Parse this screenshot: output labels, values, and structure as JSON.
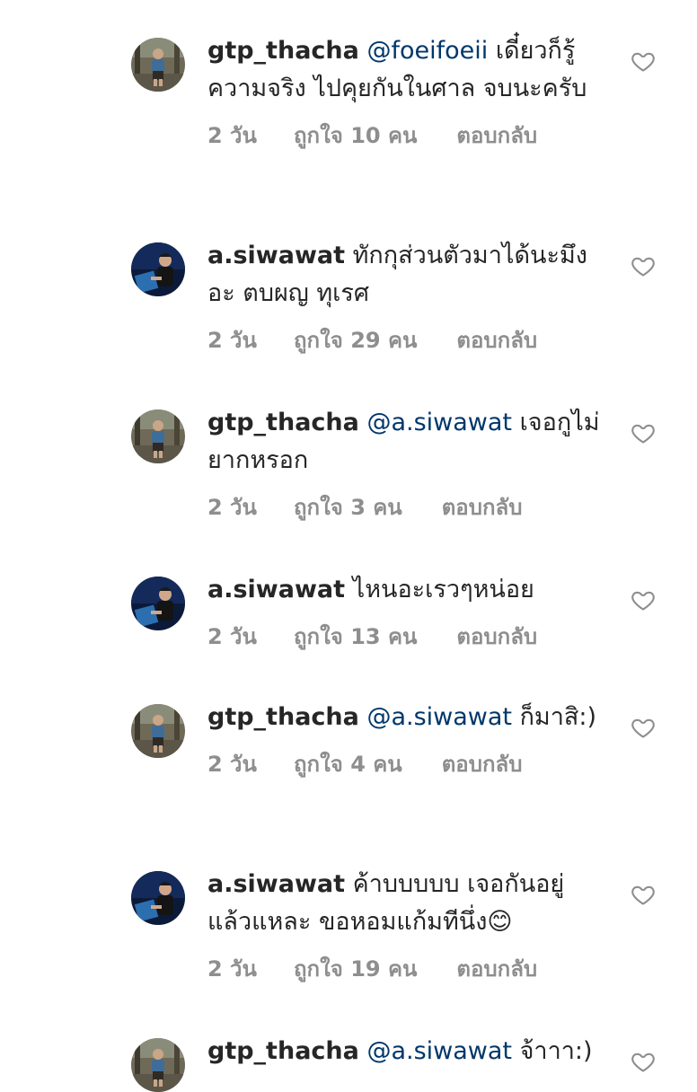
{
  "comments": [
    {
      "username": "gtp_thacha",
      "mention": "@foeifoeii",
      "text": " เดี๋ยวก็รู้ความจริง ไปคุยกันในศาล จบนะครับ",
      "time": "2 วัน",
      "likes": "ถูกใจ 10 คน",
      "reply": "ตอบกลับ",
      "avatar": "gtp"
    },
    {
      "username": "a.siwawat",
      "mention": "",
      "text": " ทักกุส่วนตัวมาได้นะมึงอะ ตบผญ ทุเรศ",
      "time": "2 วัน",
      "likes": "ถูกใจ 29 คน",
      "reply": "ตอบกลับ",
      "avatar": "siwawat"
    },
    {
      "username": "gtp_thacha",
      "mention": "@a.siwawat",
      "text": " เจอกูไม่ยากหรอก",
      "time": "2 วัน",
      "likes": "ถูกใจ 3 คน",
      "reply": "ตอบกลับ",
      "avatar": "gtp"
    },
    {
      "username": "a.siwawat",
      "mention": "",
      "text": " ไหนอะเรวๆหน่อย",
      "time": "2 วัน",
      "likes": "ถูกใจ 13 คน",
      "reply": "ตอบกลับ",
      "avatar": "siwawat"
    },
    {
      "username": "gtp_thacha",
      "mention": "@a.siwawat",
      "text": " ก็มาสิ:)",
      "time": "2 วัน",
      "likes": "ถูกใจ 4 คน",
      "reply": "ตอบกลับ",
      "avatar": "gtp"
    },
    {
      "username": "a.siwawat",
      "mention": "",
      "text": " ค้าบบบบบ เจอกันอยู่แล้วแหละ ขอหอมแก้มทีนึ่ง😊",
      "time": "2 วัน",
      "likes": "ถูกใจ 19 คน",
      "reply": "ตอบกลับ",
      "avatar": "siwawat"
    },
    {
      "username": "gtp_thacha",
      "mention": "@a.siwawat",
      "text": " จ้าาา:)",
      "time": "",
      "likes": "",
      "reply": "",
      "avatar": "gtp"
    }
  ],
  "icons": {
    "like": "heart-outline-icon"
  },
  "colors": {
    "username": "#262626",
    "mention": "#00376b",
    "meta": "#8e8e8e",
    "heart": "#8e8e8e"
  }
}
